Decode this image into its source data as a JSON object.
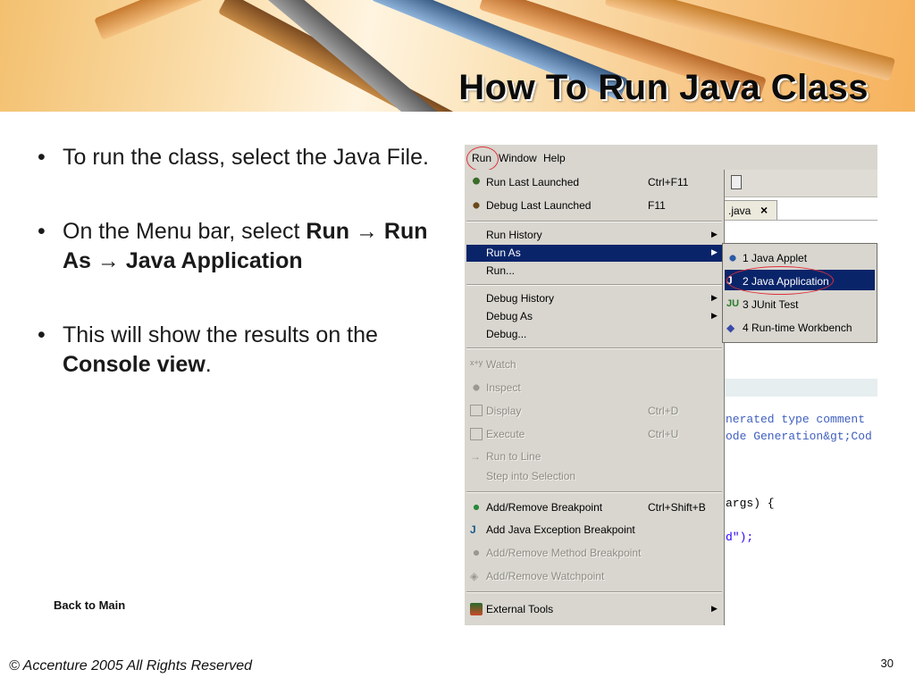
{
  "slide": {
    "title": "How To Run Java Class",
    "bullets": [
      {
        "text": "To run the class, select the Java File."
      },
      {
        "prefix": "On the Menu bar, select ",
        "run": "Run",
        "arrow": "→",
        "run_as": "Run As",
        "java_app": "Java Application"
      },
      {
        "prefix": "This will show the results on the ",
        "bold": "Console view",
        "suffix": "."
      }
    ],
    "back_link": "Back to Main",
    "copyright": "© Accenture 2005 All Rights Reserved",
    "page_number": "30"
  },
  "screenshot": {
    "menubar": {
      "run": "Run",
      "window": "Window",
      "help": "Help"
    },
    "editor_tab": ".java",
    "code_lines": [
      "nerated type comment",
      "ode Generation&gt;Cod",
      "args) {",
      "d\");"
    ],
    "run_menu": {
      "items": [
        {
          "label": "Run Last Launched",
          "shortcut": "Ctrl+F11"
        },
        {
          "label": "Debug Last Launched",
          "shortcut": "F11"
        },
        {
          "label": "Run History"
        },
        {
          "label": "Run As"
        },
        {
          "label": "Run..."
        },
        {
          "label": "Debug History"
        },
        {
          "label": "Debug As"
        },
        {
          "label": "Debug..."
        },
        {
          "label": "Watch"
        },
        {
          "label": "Inspect"
        },
        {
          "label": "Display",
          "shortcut": "Ctrl+D"
        },
        {
          "label": "Execute",
          "shortcut": "Ctrl+U"
        },
        {
          "label": "Run to Line"
        },
        {
          "label": "Step into Selection"
        },
        {
          "label": "Add/Remove Breakpoint",
          "shortcut": "Ctrl+Shift+B"
        },
        {
          "label": "Add Java Exception Breakpoint"
        },
        {
          "label": "Add/Remove Method Breakpoint"
        },
        {
          "label": "Add/Remove Watchpoint"
        },
        {
          "label": "External Tools"
        }
      ]
    },
    "run_as_submenu": [
      {
        "label": "1 Java Applet"
      },
      {
        "label": "2 Java Application"
      },
      {
        "label": "3 JUnit Test"
      },
      {
        "label": "4 Run-time Workbench"
      }
    ],
    "colors": {
      "selection": "#0a246a",
      "highlight_circle": "#e0303a",
      "menu_bg": "#d8d6cf"
    }
  }
}
